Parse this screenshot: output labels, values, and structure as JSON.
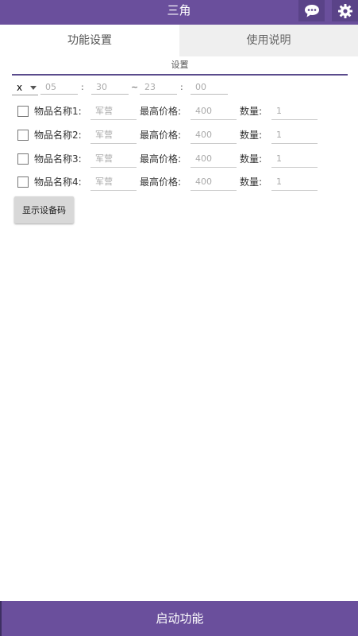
{
  "app": {
    "title": "三角",
    "brand_color": "#6a4f9c",
    "header_icons": [
      "chat-bubble-icon",
      "gear-icon"
    ]
  },
  "tabs": [
    {
      "label": "功能设置",
      "active": true
    },
    {
      "label": "使用说明",
      "active": false
    }
  ],
  "settings": {
    "title": "设置",
    "mode_select": "x",
    "start_hour": "05",
    "start_minute": "30",
    "tilde": "~",
    "colon": ":",
    "end_hour": "23",
    "end_minute": "00"
  },
  "items": [
    {
      "label": "物品名称1:",
      "name": "军营",
      "price_label": "最高价格:",
      "price": "400",
      "qty_label": "数量:",
      "qty": "1",
      "checked": false
    },
    {
      "label": "物品名称2:",
      "name": "军营",
      "price_label": "最高价格:",
      "price": "400",
      "qty_label": "数量:",
      "qty": "1",
      "checked": false
    },
    {
      "label": "物品名称3:",
      "name": "军营",
      "price_label": "最高价格:",
      "price": "400",
      "qty_label": "数量:",
      "qty": "1",
      "checked": false
    },
    {
      "label": "物品名称4:",
      "name": "军营",
      "price_label": "最高价格:",
      "price": "400",
      "qty_label": "数量:",
      "qty": "1",
      "checked": false
    }
  ],
  "buttons": {
    "show_device_code": "显示设备码",
    "start": "启动功能"
  }
}
